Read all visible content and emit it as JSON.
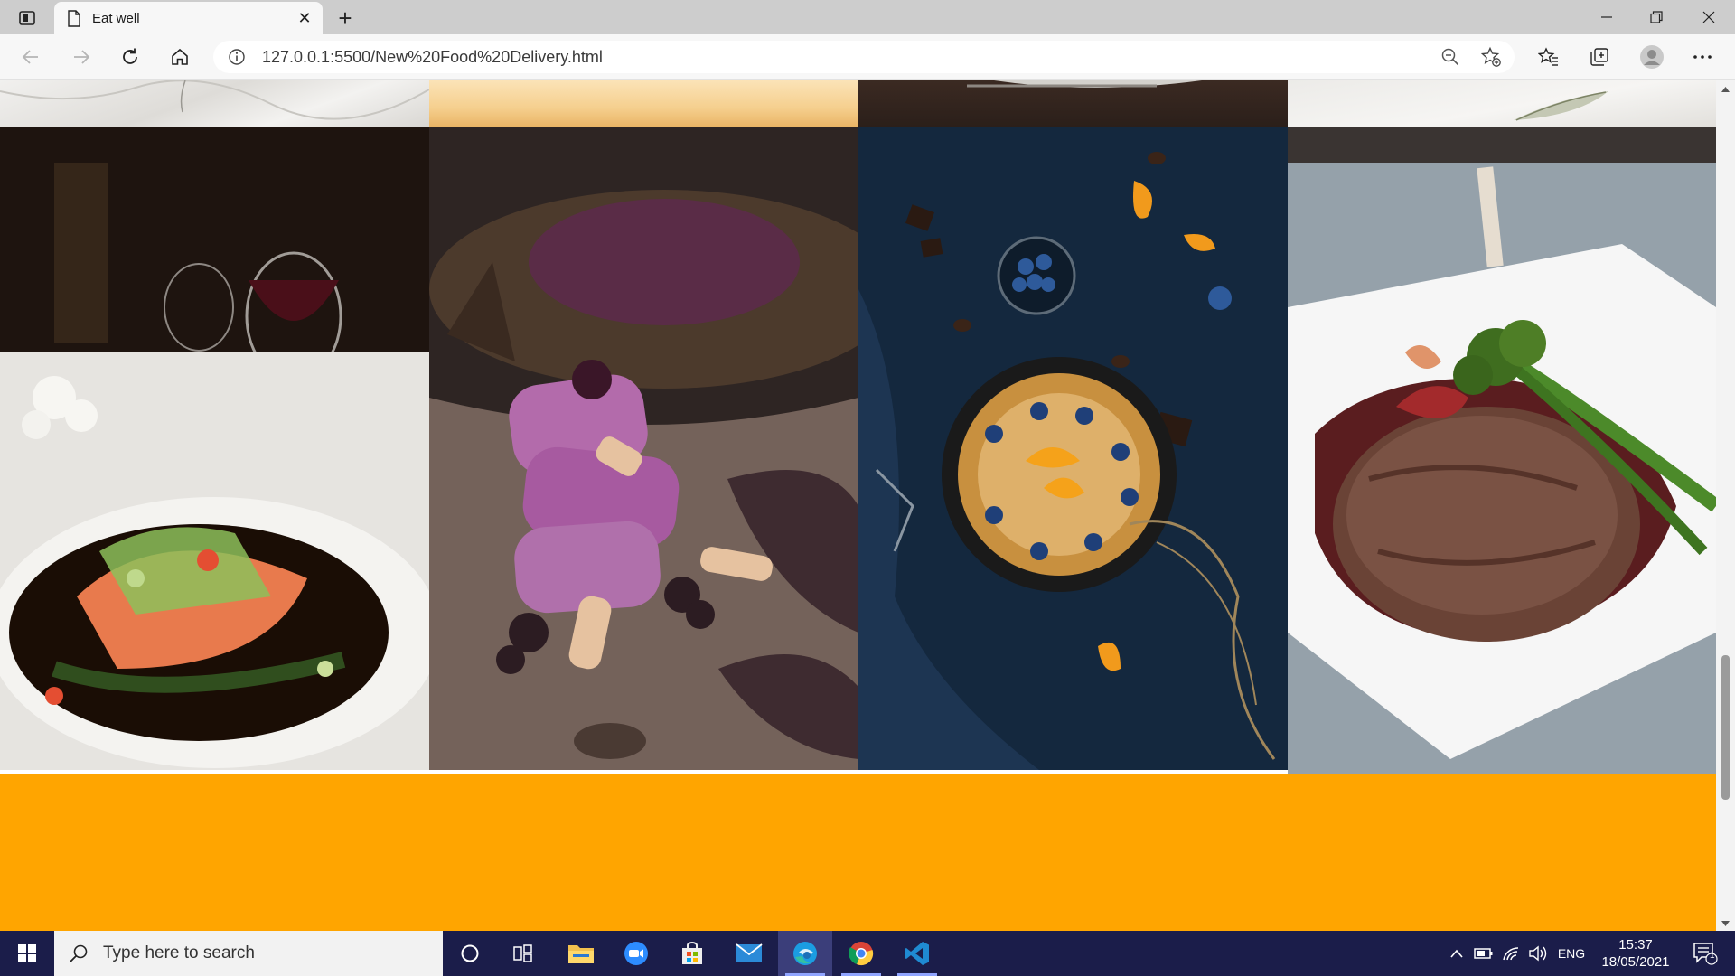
{
  "browser": {
    "tab_title": "Eat well",
    "url": "127.0.0.1:5500/New%20Food%20Delivery.html",
    "new_tab_symbol": "+",
    "close_tab_symbol": "✕"
  },
  "page": {
    "photos": [
      {
        "name": "marble-table-top",
        "subject": "marble table top"
      },
      {
        "name": "peach-gradient-top",
        "subject": "peach background"
      },
      {
        "name": "dark-plate-top",
        "subject": "dark plate with fork"
      },
      {
        "name": "light-marble-top",
        "subject": "light marble with leaf"
      },
      {
        "name": "salmon-dish",
        "subject": "salmon with vegetables and wine"
      },
      {
        "name": "berry-popsicles",
        "subject": "purple berry ice pops"
      },
      {
        "name": "pancake-skillet",
        "subject": "pancakes in skillet with blueberries and orange"
      },
      {
        "name": "steak-plate",
        "subject": "steak with broccolini on white plate"
      }
    ],
    "footer_color": "#ffa500"
  },
  "taskbar": {
    "search_placeholder": "Type here to search",
    "apps": [
      "cortana-icon",
      "task-view-icon",
      "file-explorer-icon",
      "zoom-icon",
      "store-icon",
      "mail-icon",
      "edge-icon",
      "chrome-icon",
      "vscode-icon"
    ],
    "language": "ENG",
    "time": "15:37",
    "date": "18/05/2021",
    "notification_count": "1"
  }
}
